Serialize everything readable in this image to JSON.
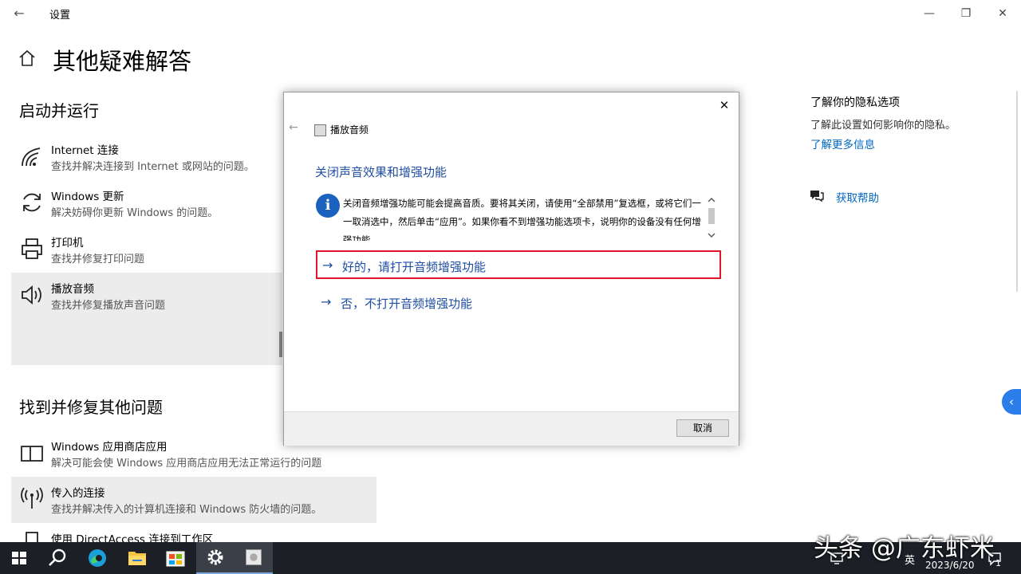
{
  "window": {
    "title": "设置",
    "back_glyph": "←",
    "minimize_glyph": "—",
    "restore_glyph": "❐",
    "close_glyph": "✕"
  },
  "page": {
    "title": "其他疑难解答"
  },
  "sections": {
    "startup": "启动并运行",
    "other": "找到并修复其他问题"
  },
  "items": [
    {
      "title": "Internet 连接",
      "desc": "查找并解决连接到 Internet 或网站的问题。",
      "icon": "wifi-icon"
    },
    {
      "title": "Windows 更新",
      "desc": "解决妨碍你更新 Windows 的问题。",
      "icon": "refresh-icon"
    },
    {
      "title": "打印机",
      "desc": "查找并修复打印问题",
      "icon": "printer-icon"
    },
    {
      "title": "播放音频",
      "desc": "查找并修复播放声音问题",
      "icon": "speaker-icon"
    },
    {
      "title": "Windows 应用商店应用",
      "desc": "解决可能会使 Windows 应用商店应用无法正常运行的问题",
      "icon": "store-app-icon"
    },
    {
      "title": "传入的连接",
      "desc": "查找并解决传入的计算机连接和 Windows 防火墙的问题。",
      "icon": "antenna-icon"
    },
    {
      "title": "使用 DirectAccess 连接到工作区",
      "icon": "workplace-icon"
    }
  ],
  "right_pane": {
    "privacy_title": "了解你的隐私选项",
    "privacy_desc": "了解此设置如何影响你的隐私。",
    "privacy_link": "了解更多信息",
    "help_link": "获取帮助"
  },
  "dialog": {
    "app_title": "播放音频",
    "heading": "关闭声音效果和增强功能",
    "info_text": "关闭音频增强功能可能会提高音质。要将其关闭，请使用“全部禁用”复选框，或将它们一一取消选中，然后单击“应用”。如果你看不到增强功能选项卡，说明你的设备没有任何增强功能",
    "options": [
      {
        "arrow": "→",
        "label": "好的，请打开音频增强功能",
        "highlighted": true
      },
      {
        "arrow": "→",
        "label": "否，不打开音频增强功能",
        "highlighted": false
      }
    ],
    "cancel_label": "取消",
    "close_glyph": "✕",
    "back_glyph": "←"
  },
  "taskbar": {
    "language": "英",
    "date": "2023/6/20",
    "notification_count": "1"
  },
  "watermark": "头条 @广东虾米",
  "colors": {
    "accent": "#0067c0",
    "dialog_link": "#1f4ea3",
    "highlight": "#e0162b",
    "taskbar": "#1c2026"
  }
}
